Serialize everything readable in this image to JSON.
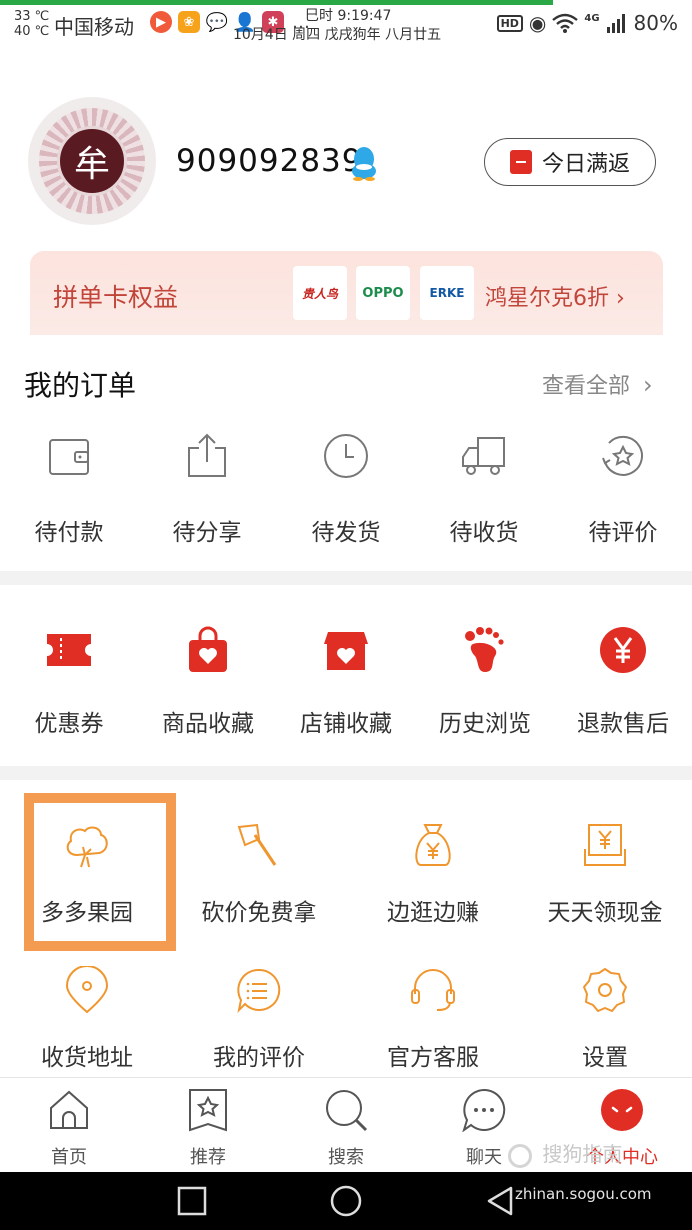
{
  "status_bar": {
    "temp_high": "33 ℃",
    "temp_low": "40 ℃",
    "carrier": "中国移动",
    "time": "巳时 9:19:47",
    "date": "10月4日 周四 戊戌狗年 八月廿五",
    "hd": "HD",
    "network": "4G",
    "battery": "80%"
  },
  "profile": {
    "avatar_char": "牟",
    "username": "909092839",
    "daily_button": "今日满返"
  },
  "benefits": {
    "title": "拼单卡权益",
    "brands": [
      "贵人鸟",
      "OPPO",
      "ERKE"
    ],
    "promo": "鸿星尔克6折"
  },
  "orders": {
    "title": "我的订单",
    "view_all": "查看全部",
    "items": [
      {
        "label": "待付款",
        "icon": "wallet-icon"
      },
      {
        "label": "待分享",
        "icon": "share-box-icon"
      },
      {
        "label": "待发货",
        "icon": "clock-icon"
      },
      {
        "label": "待收货",
        "icon": "truck-icon"
      },
      {
        "label": "待评价",
        "icon": "review-star-icon"
      }
    ]
  },
  "functions": {
    "items": [
      {
        "label": "优惠券",
        "icon": "coupon-icon"
      },
      {
        "label": "商品收藏",
        "icon": "bag-heart-icon"
      },
      {
        "label": "店铺收藏",
        "icon": "shop-heart-icon"
      },
      {
        "label": "历史浏览",
        "icon": "footprint-icon"
      },
      {
        "label": "退款售后",
        "icon": "yuan-circle-icon"
      }
    ]
  },
  "tools": {
    "row1": [
      {
        "label": "多多果园",
        "icon": "tree-icon"
      },
      {
        "label": "砍价免费拿",
        "icon": "axe-icon"
      },
      {
        "label": "边逛边赚",
        "icon": "money-bag-icon"
      },
      {
        "label": "天天领现金",
        "icon": "cash-envelope-icon"
      }
    ],
    "row2": [
      {
        "label": "收货地址",
        "icon": "location-icon"
      },
      {
        "label": "我的评价",
        "icon": "comment-icon"
      },
      {
        "label": "官方客服",
        "icon": "headset-icon"
      },
      {
        "label": "设置",
        "icon": "settings-icon"
      }
    ]
  },
  "tabbar": {
    "items": [
      {
        "label": "首页",
        "icon": "home-icon"
      },
      {
        "label": "推荐",
        "icon": "recommend-icon"
      },
      {
        "label": "搜索",
        "icon": "search-icon"
      },
      {
        "label": "聊天",
        "icon": "chat-icon"
      },
      {
        "label": "个人中心",
        "icon": "profile-face-icon",
        "active": true
      }
    ]
  },
  "watermark": {
    "text": "搜狗指南",
    "url": "zhinan.sogou.com"
  },
  "colors": {
    "brand_red": "#e02e24",
    "orange": "#f0962e",
    "highlight": "#f39b50"
  }
}
